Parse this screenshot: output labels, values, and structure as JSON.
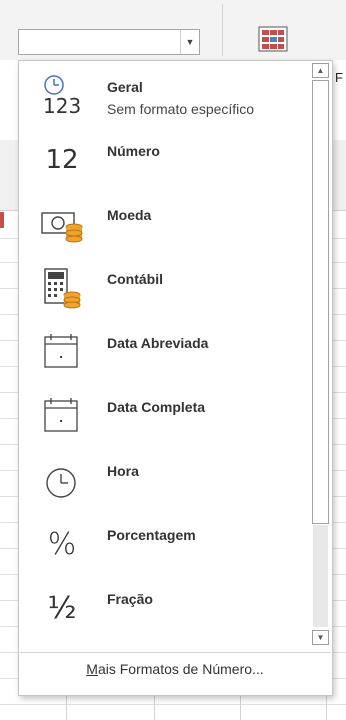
{
  "ribbon": {
    "number_format_value": "",
    "dropdown_arrow": "chevron-down-icon",
    "partial_label": "F"
  },
  "formats": [
    {
      "id": "general",
      "title": "Geral",
      "subtitle": "Sem formato específico",
      "icon": "clock-123-icon",
      "glyph": "123"
    },
    {
      "id": "number",
      "title": "Número",
      "subtitle": "",
      "icon": "number-12-icon",
      "glyph": "12"
    },
    {
      "id": "currency",
      "title": "Moeda",
      "subtitle": "",
      "icon": "currency-icon",
      "glyph": ""
    },
    {
      "id": "accounting",
      "title": "Contábil",
      "subtitle": "",
      "icon": "calculator-icon",
      "glyph": ""
    },
    {
      "id": "short-date",
      "title": "Data Abreviada",
      "subtitle": "",
      "icon": "calendar-icon",
      "glyph": ""
    },
    {
      "id": "long-date",
      "title": "Data Completa",
      "subtitle": "",
      "icon": "calendar-icon",
      "glyph": ""
    },
    {
      "id": "time",
      "title": "Hora",
      "subtitle": "",
      "icon": "clock-icon",
      "glyph": ""
    },
    {
      "id": "percentage",
      "title": "Porcentagem",
      "subtitle": "",
      "icon": "percent-icon",
      "glyph": "%"
    },
    {
      "id": "fraction",
      "title": "Fração",
      "subtitle": "",
      "icon": "fraction-icon",
      "glyph": "½"
    }
  ],
  "footer": {
    "more_formats_accel": "M",
    "more_formats_rest": "ais Formatos de Número..."
  },
  "colors": {
    "accent_red": "#c0504d",
    "coin_gold": "#f0a22e",
    "text": "#333333"
  }
}
